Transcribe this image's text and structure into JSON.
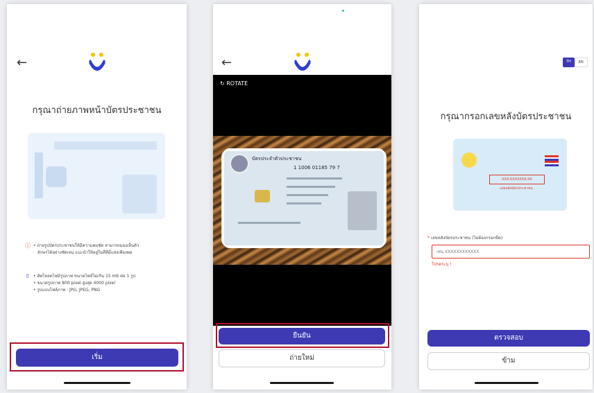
{
  "screen1": {
    "title": "กรุณาถ่ายภาพหน้าบัตรประชาชน",
    "tip1_line1": "• ถ่ายรูปบัตรประชาชนให้มีความคมชัด สามารถมองเห็นตัว",
    "tip1_line2": "อักษรได้อย่างชัดเจน แนะนำให้อยู่ในที่ที่มีแสงเพียงพอ",
    "tip2_line1": "• อัพโหลดไฟล์รูปภาพ ขนาดไฟล์ไม่เกิน 15 mb ต่อ 1 รูป",
    "tip2_line2": "• ขนาดรูปภาพ 800 pixel สูงสุด 4000 pixel",
    "tip2_line3": "• รูปแบบไฟล์ภาพ : JPG, JPEG, PNG",
    "start_button": "เริ่ม"
  },
  "screen2": {
    "rotate_label": "ROTATE",
    "card_header": "บัตรประจำตัวประชาชน",
    "card_id": "1 1006 01185 79 7",
    "confirm_button": "ยืนยัน",
    "retake_button": "ถ่ายใหม่"
  },
  "screen3": {
    "lang_th": "TH",
    "lang_en": "EN",
    "title": "กรุณากรอกเลขหลังบัตรประชาชน",
    "card_code": "XXX-XXXXXXX-XX",
    "card_caption": "เลขหลังบัตรประชาชน",
    "field_label": "เลขหลังบัตรประชาชน (ไม่ต้องกรอกขีด)",
    "field_required_mark": "*",
    "field_placeholder": "เช่น XXXXXXXXXXXX",
    "field_error": "โปรดระบุ !",
    "verify_button": "ตรวจสอบ",
    "skip_button": "ข้าม"
  },
  "colors": {
    "primary": "#3d3ab4",
    "highlight": "#b0102e",
    "logo_blue": "#2f3ecf",
    "logo_yellow": "#f5c400",
    "error": "#e0342b"
  }
}
